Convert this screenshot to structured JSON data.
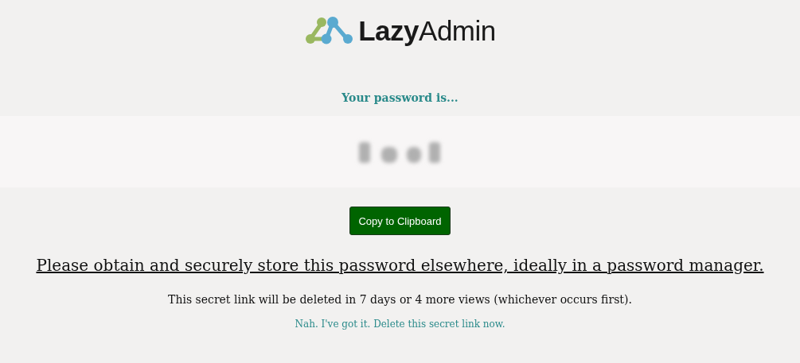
{
  "logo": {
    "text": "**Lazy**Admin"
  },
  "password_label": "Your password is...",
  "copy_button": "Copy to Clipboard",
  "warning": "Please obtain and securely store this password elsewhere, ideally in a password manager.",
  "expiry_note": "This secret link will be deleted in 7 days or 4 more views (whichever occurs first).",
  "delete_link": "Nah. I've got it. Delete this secret link now."
}
